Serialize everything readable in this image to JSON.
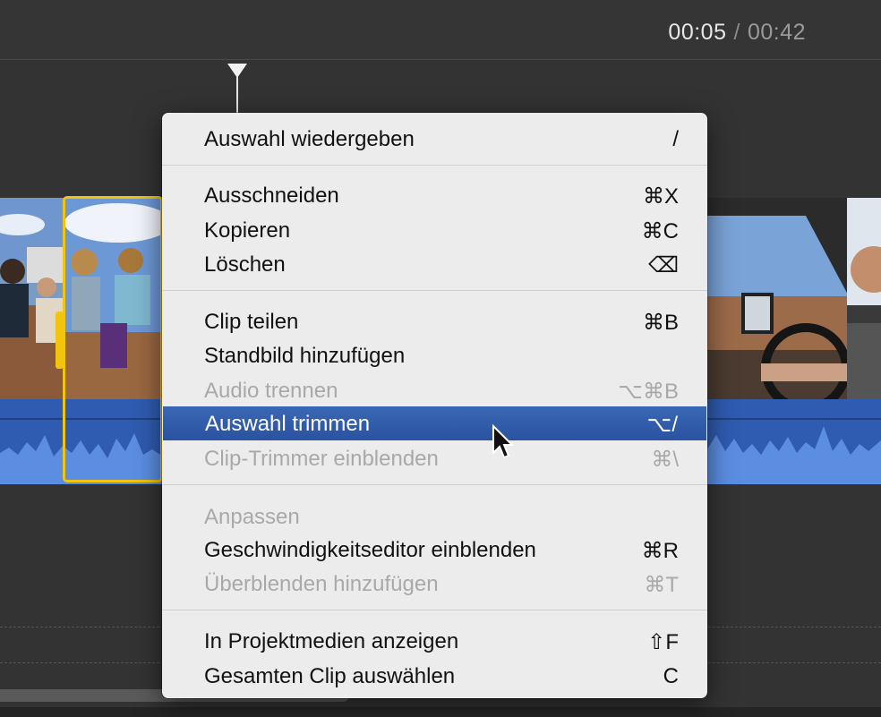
{
  "timecode": {
    "current": "00:05",
    "separator": "/",
    "total": "00:42"
  },
  "menu": {
    "items": [
      {
        "label": "Auswahl wiedergeben",
        "shortcut": "/",
        "enabled": true
      },
      {
        "label": "Ausschneiden",
        "shortcut": "⌘X",
        "enabled": true
      },
      {
        "label": "Kopieren",
        "shortcut": "⌘C",
        "enabled": true
      },
      {
        "label": "Löschen",
        "shortcut": "⌫",
        "enabled": true
      },
      {
        "label": "Clip teilen",
        "shortcut": "⌘B",
        "enabled": true
      },
      {
        "label": "Standbild hinzufügen",
        "shortcut": "",
        "enabled": true
      },
      {
        "label": "Audio trennen",
        "shortcut": "⌥⌘B",
        "enabled": false
      },
      {
        "label": "Auswahl trimmen",
        "shortcut": "⌥/",
        "enabled": true,
        "highlighted": true
      },
      {
        "label": "Clip-Trimmer einblenden",
        "shortcut": "⌘\\",
        "enabled": false
      },
      {
        "label": "Anpassen",
        "shortcut": "",
        "enabled": false
      },
      {
        "label": "Geschwindigkeitseditor einblenden",
        "shortcut": "⌘R",
        "enabled": true
      },
      {
        "label": "Überblenden hinzufügen",
        "shortcut": "⌘T",
        "enabled": false
      },
      {
        "label": "In Projektmedien anzeigen",
        "shortcut": "⇧F",
        "enabled": true
      },
      {
        "label": "Gesamten Clip auswählen",
        "shortcut": "C",
        "enabled": true
      }
    ]
  },
  "colors": {
    "selection": "#f1c40f",
    "highlight": "#2f5bb0",
    "audio": "#2f5bb0"
  },
  "icons": {
    "pointer": "arrow-cursor-icon",
    "playhead": "playhead-icon"
  }
}
